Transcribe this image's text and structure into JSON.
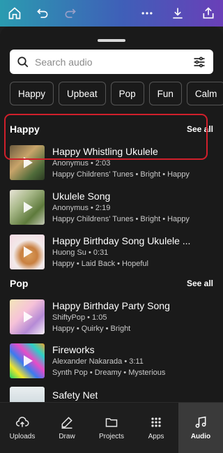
{
  "topbar": {
    "icons": [
      "home-icon",
      "undo-icon",
      "redo-icon",
      "more-icon",
      "download-icon",
      "share-icon"
    ]
  },
  "search": {
    "placeholder": "Search audio"
  },
  "chips": [
    "Happy",
    "Upbeat",
    "Pop",
    "Fun",
    "Calm"
  ],
  "sections": [
    {
      "title": "Happy",
      "see_all": "See all",
      "tracks": [
        {
          "title": "Happy Whistling Ukulele",
          "artist_duration": "Anonymus • 2:03",
          "tags": "Happy Childrens' Tunes • Bright • Happy",
          "selected": true
        },
        {
          "title": "Ukulele Song",
          "artist_duration": "Anonymus • 2:19",
          "tags": "Happy Childrens' Tunes • Bright • Happy"
        },
        {
          "title": "Happy Birthday Song Ukulele ...",
          "artist_duration": "Huong Su • 0:31",
          "tags": "Happy • Laid Back • Hopeful"
        }
      ]
    },
    {
      "title": "Pop",
      "see_all": "See all",
      "tracks": [
        {
          "title": "Happy Birthday Party Song",
          "artist_duration": "ShiftyPop • 1:05",
          "tags": "Happy • Quirky • Bright"
        },
        {
          "title": "Fireworks",
          "artist_duration": "Alexander Nakarada • 3:11",
          "tags": "Synth Pop • Dreamy • Mysterious"
        },
        {
          "title": "Safety Net",
          "artist_duration": "",
          "tags": ""
        }
      ]
    }
  ],
  "nav": [
    {
      "label": "Uploads",
      "icon": "cloud-upload-icon"
    },
    {
      "label": "Draw",
      "icon": "pen-icon"
    },
    {
      "label": "Projects",
      "icon": "folder-icon"
    },
    {
      "label": "Apps",
      "icon": "apps-grid-icon"
    },
    {
      "label": "Audio",
      "icon": "music-note-icon",
      "active": true
    }
  ],
  "colors": {
    "highlight": "#d01f2b",
    "background": "#1a1a1a",
    "gradient_start": "#2a9bb0",
    "gradient_end": "#6a3fb8"
  }
}
